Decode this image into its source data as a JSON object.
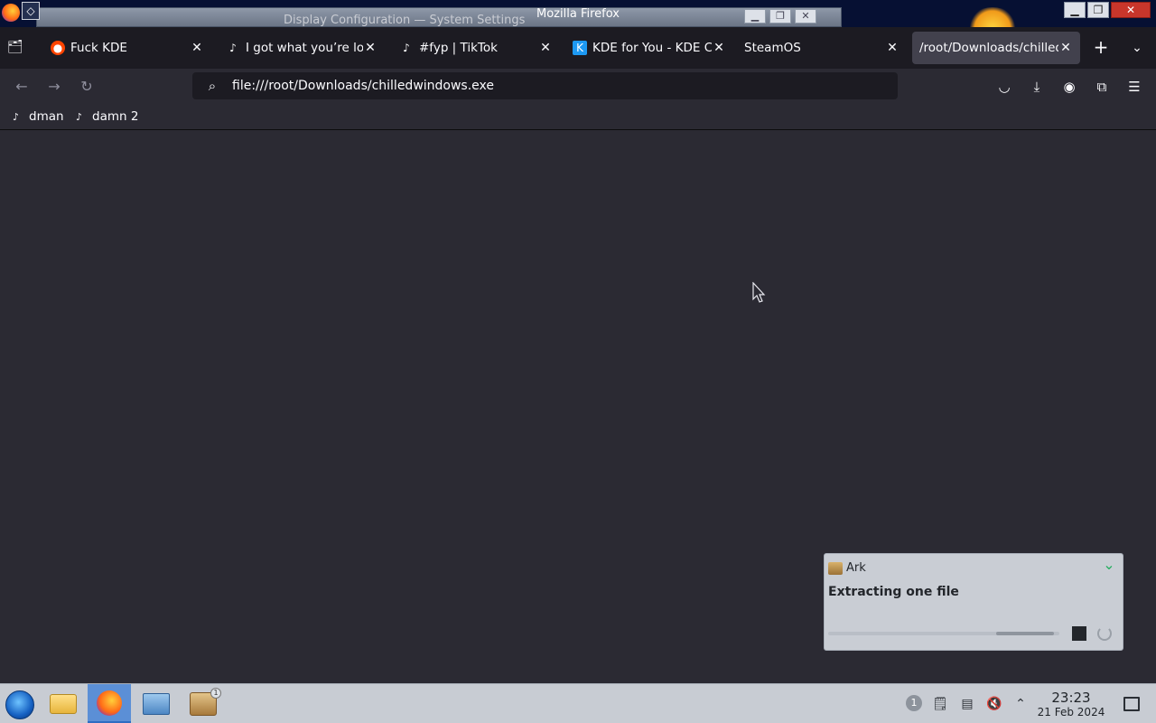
{
  "titlebar": {
    "window_title": "Mozilla Firefox",
    "background_window_title": "Display Configuration — System Settings",
    "controls": {
      "minimize": "▁",
      "maximize": "❐",
      "close": "✕"
    }
  },
  "tabs": [
    {
      "label": "Fuck KDE",
      "icon": "reddit-icon",
      "active": false
    },
    {
      "label": "I got what you’re looking for",
      "icon": "tiktok-icon",
      "active": false
    },
    {
      "label": "#fyp | TikTok",
      "icon": "tiktok-icon",
      "active": false
    },
    {
      "label": "KDE for You - KDE Community",
      "icon": "kde-icon",
      "active": false
    },
    {
      "label": "SteamOS",
      "icon": "",
      "active": false
    },
    {
      "label": "/root/Downloads/chilledwindows.exe",
      "icon": "",
      "active": true
    }
  ],
  "urlbar": {
    "url": "file:///root/Downloads/chilledwindows.exe"
  },
  "bookmarks": [
    {
      "label": "dman",
      "icon": "tiktok-icon"
    },
    {
      "label": "damn 2",
      "icon": "tiktok-icon"
    }
  ],
  "notification": {
    "app_name": "Ark",
    "message": "Extracting one file",
    "progress_fraction": 0.75
  },
  "taskbar": {
    "apps": [
      {
        "name": "file-manager",
        "active": false
      },
      {
        "name": "firefox",
        "active": true
      },
      {
        "name": "system-settings",
        "active": false
      },
      {
        "name": "ark",
        "active": false,
        "badge": "1"
      }
    ],
    "tray_badge": "1",
    "clock_time": "23:23",
    "clock_date": "21 Feb 2024"
  },
  "colors": {
    "content_bg": "#2b2a33",
    "tab_strip_bg": "#1c1b22",
    "taskbar_bg": "#c8ccd3",
    "notification_bg": "#c9cdd4"
  }
}
